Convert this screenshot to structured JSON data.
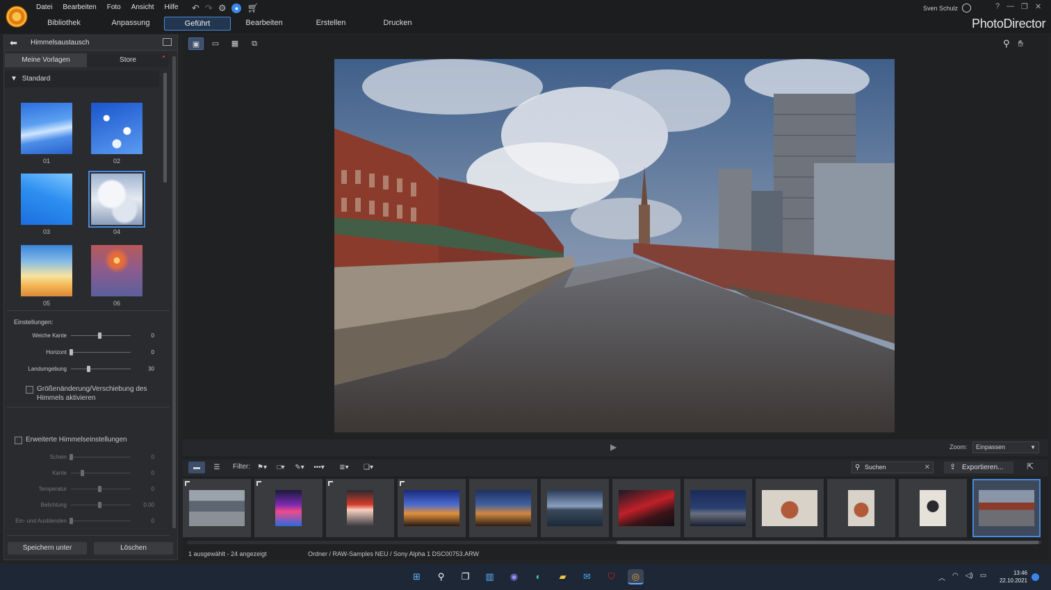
{
  "menu": [
    "Datei",
    "Bearbeiten",
    "Foto",
    "Ansicht",
    "Hilfe"
  ],
  "tabs": [
    "Bibliothek",
    "Anpassung",
    "Geführt",
    "Bearbeiten",
    "Erstellen",
    "Drucken"
  ],
  "active_tab": "Geführt",
  "user": "Sven Schulz",
  "brand": "PhotoDirector",
  "panel": {
    "title": "Himmelsaustausch",
    "tabs": [
      "Meine Vorlagen",
      "Store"
    ],
    "section": "Standard",
    "templates": [
      "01",
      "02",
      "03",
      "04",
      "05",
      "06"
    ],
    "selected_template": "04",
    "settings_title": "Einstellungen:",
    "sliders": [
      {
        "label": "Weiche Kante",
        "value": "0",
        "level": 0.5
      },
      {
        "label": "Horizont",
        "value": "0",
        "level": 0.0
      },
      {
        "label": "Landumgebung",
        "value": "30",
        "level": 0.3
      }
    ],
    "resize_checkbox": "Größenänderung/Verschiebung des Himmels aktivieren",
    "advanced_checkbox": "Erweiterte Himmelseinstellungen",
    "advanced_sliders": [
      {
        "label": "Schein",
        "value": "0",
        "level": 0.0
      },
      {
        "label": "Kante",
        "value": "0",
        "level": 0.2
      },
      {
        "label": "Temperatur",
        "value": "0",
        "level": 0.5
      },
      {
        "label": "Belichtung",
        "value": "0.00",
        "level": 0.5
      },
      {
        "label": "Ein- und Ausblenden",
        "value": "0",
        "level": 0.0
      }
    ],
    "buttons": {
      "save": "Speichern unter",
      "delete": "Löschen"
    }
  },
  "viewer": {
    "zoom_label": "Zoom:",
    "zoom_value": "Einpassen"
  },
  "filterbar": {
    "filter_label": "Filter:",
    "search_placeholder": "Suchen",
    "export_label": "Exportieren..."
  },
  "status": {
    "selection": "1 ausgewählt - 24 angezeigt",
    "path": "Ordner / RAW-Samples NEU / Sony Alpha 1 DSC00753.ARW"
  },
  "clock": {
    "time": "13:46",
    "date": "22.10.2021"
  }
}
